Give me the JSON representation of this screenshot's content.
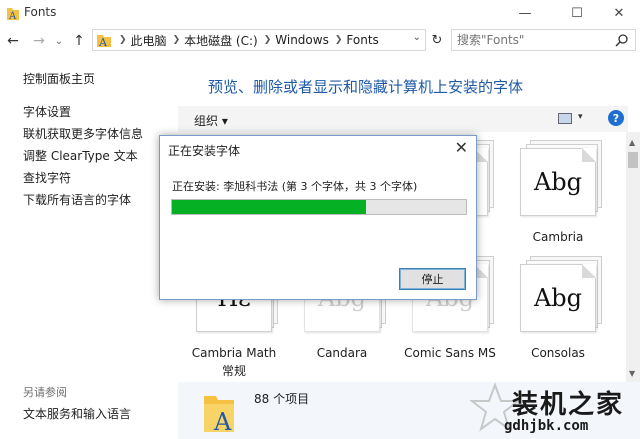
{
  "window": {
    "title": "Fonts",
    "minimize": "—",
    "maximize": "☐",
    "close": "✕"
  },
  "nav": {
    "back": "←",
    "forward": "→",
    "recent": "⌄",
    "up": "↑",
    "breadcrumb": [
      "此电脑",
      "本地磁盘 (C:)",
      "Windows",
      "Fonts"
    ],
    "address_dropdown": "⌄",
    "refresh": "↻",
    "search_placeholder": "搜索\"Fonts\""
  },
  "sidebar": {
    "links": [
      "控制面板主页",
      "字体设置",
      "联机获取更多字体信息",
      "调整 ClearType 文本",
      "查找字符",
      "下载所有语言的字体"
    ],
    "see_also_heading": "另请参阅",
    "see_also_links": [
      "文本服务和输入语言"
    ]
  },
  "main": {
    "title": "预览、删除或者显示和隐藏计算机上安装的字体",
    "toolbar": {
      "organize": "组织 ▾",
      "view_dropdown": "▾",
      "help": "?"
    }
  },
  "fonts": [
    {
      "name": "",
      "sample": "",
      "row": 0,
      "col": 2,
      "ghost": false
    },
    {
      "name": "Cambria",
      "sample": "Abg",
      "row": 0,
      "col": 3,
      "ghost": false
    },
    {
      "name": "Cambria Math",
      "name2": "常规",
      "sample": "Πε",
      "row": 1,
      "col": 0,
      "ghost": false
    },
    {
      "name": "Candara",
      "sample": "Abg",
      "row": 1,
      "col": 1,
      "ghost": true
    },
    {
      "name": "Comic Sans MS",
      "sample": "Abg",
      "row": 1,
      "col": 2,
      "ghost": true
    },
    {
      "name": "Consolas",
      "sample": "Abg",
      "row": 1,
      "col": 3,
      "ghost": false
    }
  ],
  "details": {
    "count": "88 个项目"
  },
  "watermark": {
    "text": "装机之家",
    "url": "gdhjbk.com"
  },
  "dialog": {
    "title": "正在安装字体",
    "close": "✕",
    "status": "正在安装: 李旭科书法 (第 3 个字体，共 3 个字体)",
    "progress": 0.66,
    "stop_label": "停止"
  },
  "colors": {
    "accent_link": "#1e5aa8",
    "progress_fill": "#06b025",
    "help_icon": "#1e6fd0"
  }
}
